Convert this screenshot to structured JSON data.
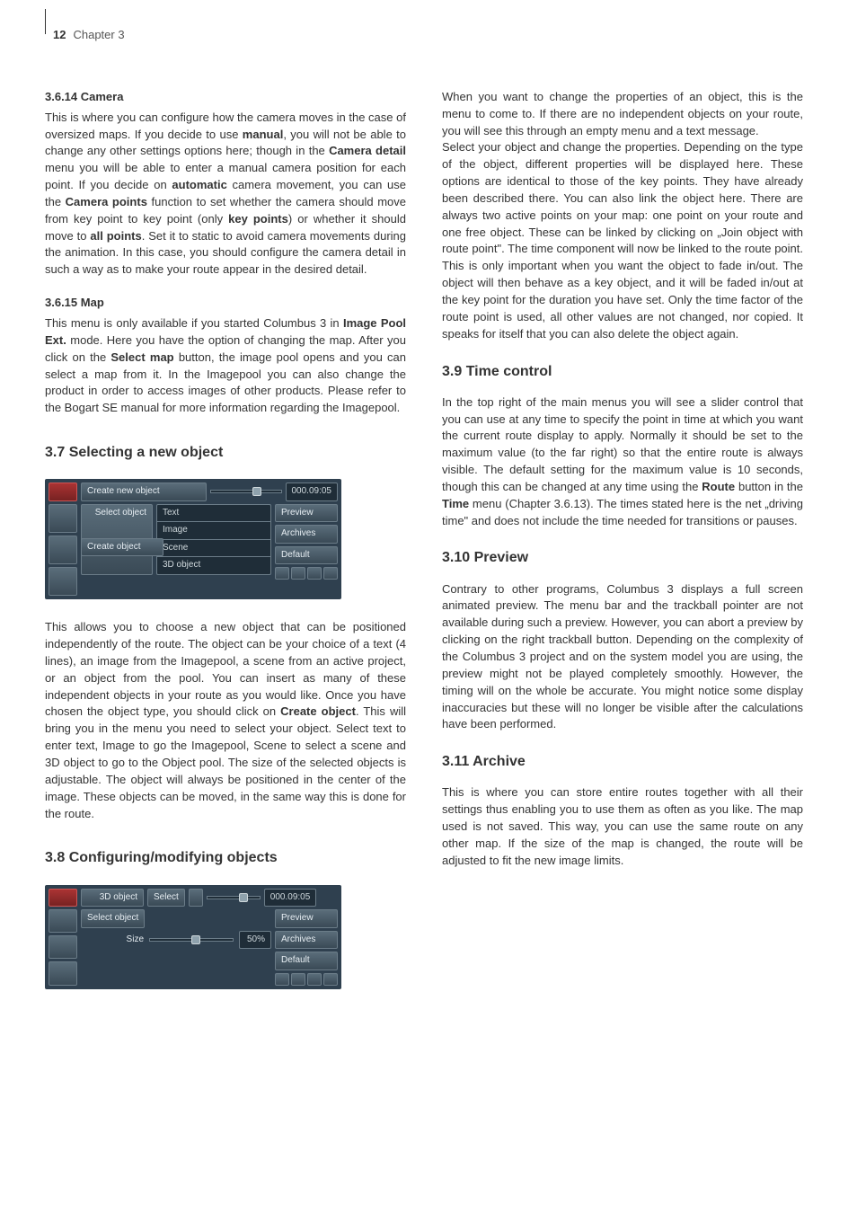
{
  "header": {
    "page": "12",
    "chapter": "Chapter 3"
  },
  "left": {
    "s3614": {
      "title": "3.6.14 Camera",
      "body": "This is where you can configure how the camera moves in the case of oversized maps. If you decide to use manual, you will not be able to change any other settings options here; though in the Camera detail menu you will be able to enter a manual camera position for each point. If you decide on automatic camera movement, you can use the Camera points function to set whether the camera should move from key point to key point (only key points) or whether it should move to all points. Set it to static to avoid camera movements during the animation. In this case, you should configure the camera detail in such a way as to make your route appear in the desired detail."
    },
    "s3615": {
      "title": "3.6.15 Map",
      "body": "This menu is only available if you started Columbus 3 in Image Pool Ext. mode. Here you have the option of changing the map. After you click on the Select map button, the image pool opens and you can select a map from it. In the Imagepool you can also change the product in order to access images of other products. Please refer to the Bogart SE manual for more information regarding the Imagepool."
    },
    "s37": {
      "title": "3.7 Selecting a new object",
      "ui": {
        "create_new_object": "Create new object",
        "time": "000.09:05",
        "select_object": "Select object",
        "create_object": "Create object",
        "opts": {
          "text": "Text",
          "image": "Image",
          "scene": "Scene",
          "d3": "3D object"
        },
        "preview": "Preview",
        "archives": "Archives",
        "default": "Default"
      },
      "body": "This allows you to choose a new object that can be positioned independently of the route. The object can be your choice of a text (4 lines), an image from the Imagepool, a scene from an active project, or an object from the pool. You can insert as many of these independent objects in your route as you would like. Once you have chosen the object type, you should click on Create object. This will bring you in the menu you need to select your object. Select text to enter text, Image to go the Imagepool, Scene to select a scene and 3D object to go to the Object pool. The size of the selected objects is adjustable. The object will always be positioned in the center of the image. These objects can be moved, in the same way this is done for the route."
    },
    "s38": {
      "title": "3.8 Configuring/modifying objects",
      "ui": {
        "d3_object": "3D object",
        "select": "Select",
        "time": "000.09:05",
        "select_object": "Select object",
        "size": "Size",
        "size_val": "50%",
        "preview": "Preview",
        "archives": "Archives",
        "default": "Default"
      }
    }
  },
  "right": {
    "intro1": "When you want to change the properties of an object, this is the menu to come to. If there are no independent objects on your route, you will see this through an empty menu and a text message.",
    "intro2": "Select your object and change the properties. Depending on the type of the object, different properties will be displayed here. These options are identical to those of the key points. They have already been described there. You can also link the object here. There are always two active points on your map: one point on your route and one free object. These can be linked by clicking on „Join object with route point\". The time component will now be linked to the route point. This is only important when you want the object to fade in/out. The object will then behave as a key object, and it will be faded in/out at the key point for the duration you have set. Only the time factor of the route point is used, all other values are not changed, nor copied. It speaks for itself that you can also delete the object again.",
    "s39": {
      "title": "3.9 Time control",
      "body": "In the top right of the main menus you will see a slider control that you can use at any time to specify the point in time at which you want the current route display to apply. Normally it should be set to the maximum value (to the far right) so that the entire route is always visible. The default setting for the maximum value is 10 seconds, though this can be changed at any time using the Route button in the Time menu (Chapter 3.6.13). The times stated here is the net „driving time\" and does not include the time needed for transitions or pauses."
    },
    "s310": {
      "title": "3.10 Preview",
      "body": "Contrary to other programs, Columbus 3 displays a full screen animated preview. The menu bar and the trackball pointer are not available during such a preview. However, you can abort a preview by clicking on the right trackball button. Depending on the complexity of the Columbus 3 project and on the system model you are using, the preview might not be played completely smoothly. However, the timing will on the whole be accurate. You might notice some display inaccuracies but these will no longer be visible after the calculations have been performed."
    },
    "s311": {
      "title": "3.11 Archive",
      "body": "This is where you can store entire routes together with all their settings thus enabling you to use them as often as you like. The map used is not saved. This way, you can use the same route on any other map. If the size of the map is changed, the route will be adjusted to fit the new image limits."
    }
  }
}
